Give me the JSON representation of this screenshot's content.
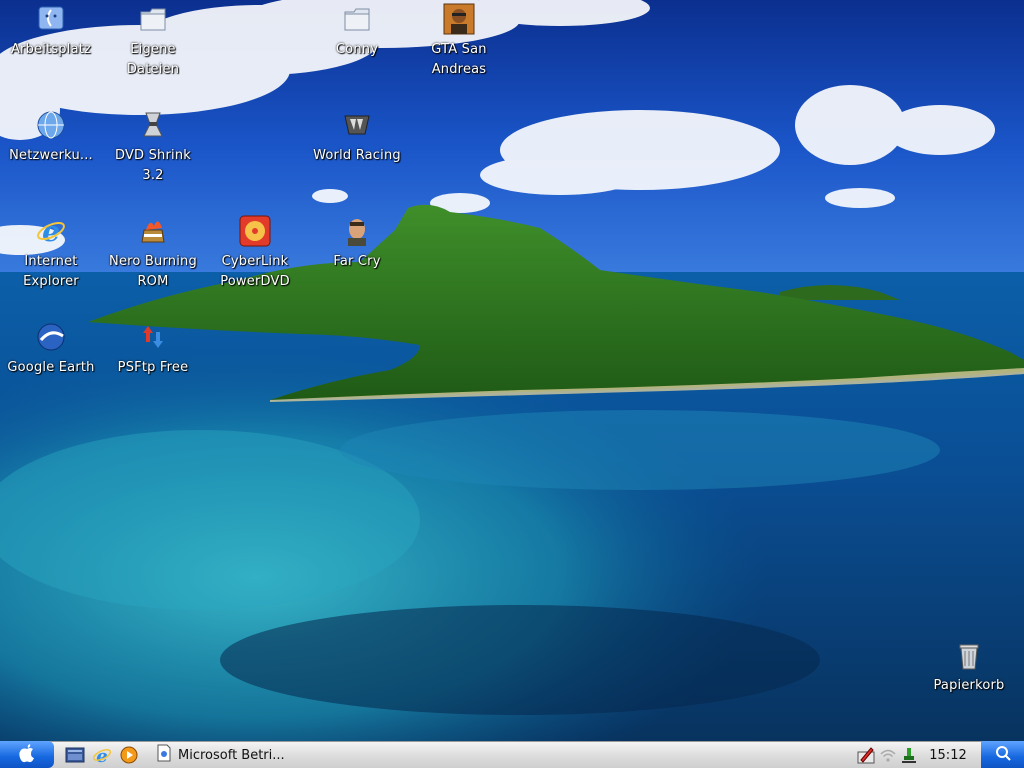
{
  "desktop": {
    "icons": [
      {
        "label": "Arbeitsplatz",
        "icon": "computer-icon"
      },
      {
        "label": "Eigene Dateien",
        "icon": "folder-icon"
      },
      {
        "label": "Conny",
        "icon": "folder-icon"
      },
      {
        "label": "GTA San Andreas",
        "icon": "game-icon"
      },
      {
        "label": "Netzwerku...",
        "icon": "network-globe-icon"
      },
      {
        "label": "DVD Shrink 3.2",
        "icon": "dvd-shrink-icon"
      },
      {
        "label": "World Racing",
        "icon": "world-racing-icon"
      },
      {
        "label": "Internet Explorer",
        "icon": "internet-explorer-icon"
      },
      {
        "label": "Nero Burning ROM",
        "icon": "nero-icon"
      },
      {
        "label": "CyberLink PowerDVD",
        "icon": "powerdvd-icon"
      },
      {
        "label": "Far Cry",
        "icon": "far-cry-icon"
      },
      {
        "label": "Google Earth",
        "icon": "google-earth-icon"
      },
      {
        "label": "PSFtp Free",
        "icon": "psftp-icon"
      },
      {
        "label": "Papierkorb",
        "icon": "recycle-bin-icon"
      }
    ]
  },
  "taskbar": {
    "start_icon": "apple-logo-icon",
    "quick_launch": [
      "show-desktop-icon",
      "internet-explorer-icon",
      "media-player-icon"
    ],
    "active_task": {
      "label": "Microsoft Betri...",
      "icon": "document-icon"
    },
    "tray": [
      "pen-tablet-icon",
      "wireless-icon",
      "network-plug-icon"
    ],
    "clock": "15:12",
    "search_icon": "search-icon"
  },
  "colors": {
    "sky": "#0a3fa0",
    "sea": "#0b6aa8",
    "island": "#2e7a1e",
    "taskbar": "#dcdcdc",
    "accent": "#1667e0"
  }
}
